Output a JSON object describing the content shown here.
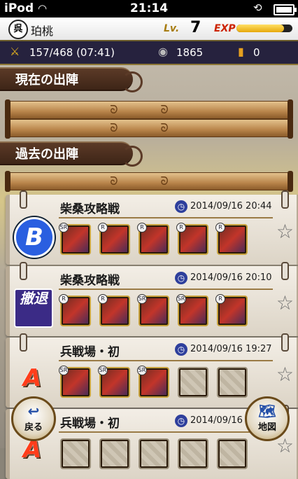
{
  "status": {
    "carrier": "iPod",
    "time": "21:14"
  },
  "user": {
    "crest": "呉",
    "name": "珀桃",
    "lv_label": "Lv.",
    "level": "7",
    "exp_label": "EXP",
    "exp_fraction": 0.85
  },
  "resources": {
    "stamina": "157/468 (07:41)",
    "coins": "1865",
    "tickets": "0"
  },
  "sections": {
    "current": "現在の出陣",
    "past": "過去の出陣"
  },
  "roll_glyph": "ᘐ ᘐ",
  "history": [
    {
      "grade": "B",
      "title": "柴桑攻略戦",
      "date": "2014/09/16 20:44",
      "units": [
        "SR",
        "R",
        "R",
        "R",
        "R"
      ]
    },
    {
      "grade": "撤退",
      "title": "柴桑攻略戦",
      "date": "2014/09/16 20:10",
      "units": [
        "R",
        "R",
        "SR",
        "SR",
        "R"
      ]
    },
    {
      "grade": "A",
      "title": "兵戦場・初",
      "date": "2014/09/16 19:27",
      "units": [
        "SR",
        "SR",
        "SR",
        "",
        ""
      ]
    },
    {
      "grade": "A",
      "title": "兵戦場・初",
      "date": "2014/09/16 19:08",
      "units": [
        "",
        "",
        "",
        "",
        ""
      ]
    }
  ],
  "buttons": {
    "back": "戻る",
    "map": "地図"
  }
}
